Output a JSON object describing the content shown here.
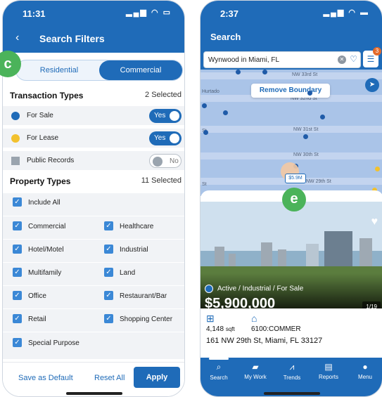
{
  "left_phone": {
    "status": {
      "time": "11:31",
      "signal": "▂▄▆ ◠ ▭"
    },
    "header": {
      "back_icon": "chevron-left-icon",
      "title": "Search Filters"
    },
    "badge_label": "c",
    "segment": {
      "options": [
        "Residential",
        "Commercial"
      ],
      "selected": "Commercial"
    },
    "transaction": {
      "title": "Transaction Types",
      "count": "2 Selected",
      "items": [
        {
          "label": "For Sale",
          "color": "#1f6bb8",
          "toggle": "Yes",
          "on": true
        },
        {
          "label": "For Lease",
          "color": "#f2c12e",
          "toggle": "Yes",
          "on": true
        },
        {
          "label": "Public Records",
          "color": "#9aa4ae",
          "toggle": "No",
          "on": false
        }
      ]
    },
    "property": {
      "title": "Property Types",
      "count": "11 Selected",
      "include_all": "Include All",
      "left_col": [
        "Commercial",
        "Hotel/Motel",
        "Multifamily",
        "Office",
        "Retail",
        "Special Purpose"
      ],
      "right_col": [
        "Healthcare",
        "Industrial",
        "Land",
        "Restaurant/Bar",
        "Shopping Center"
      ]
    },
    "footer": {
      "save_default": "Save as Default",
      "reset_all": "Reset All",
      "apply": "Apply"
    }
  },
  "right_phone": {
    "status": {
      "time": "2:37",
      "signal": "▂▄▆ ◠ ▬"
    },
    "title": "Search",
    "search_value": "Wynwood in Miami, FL",
    "filter_count": "3",
    "map": {
      "remove_boundary": "Remove Boundary",
      "labels": [
        "Hurtado",
        "NW 33rd St",
        "NW 32nd St",
        "NW 31st St",
        "NW 30th St",
        "NW 29th St",
        "St",
        "St"
      ],
      "price_pin": "$5.9M"
    },
    "badge_label": "e",
    "listing": {
      "status": "Active / Industrial / For Sale",
      "price": "$5,900,000",
      "photo_count": "1/19",
      "sqft_value": "4,148",
      "sqft_unit": "sqft",
      "zoning": "6100:COMMER",
      "address": "161 NW 29th St, Miami, FL 33127"
    },
    "tabs": [
      {
        "label": "Search",
        "icon": "search-icon",
        "glyph": "⌕",
        "active": true
      },
      {
        "label": "My Work",
        "icon": "briefcase-icon",
        "glyph": "▰",
        "active": false
      },
      {
        "label": "Trends",
        "icon": "trends-icon",
        "glyph": "⩘",
        "active": false
      },
      {
        "label": "Reports",
        "icon": "reports-icon",
        "glyph": "▤",
        "active": false
      },
      {
        "label": "Menu",
        "icon": "menu-icon",
        "glyph": "●",
        "active": false
      }
    ]
  }
}
